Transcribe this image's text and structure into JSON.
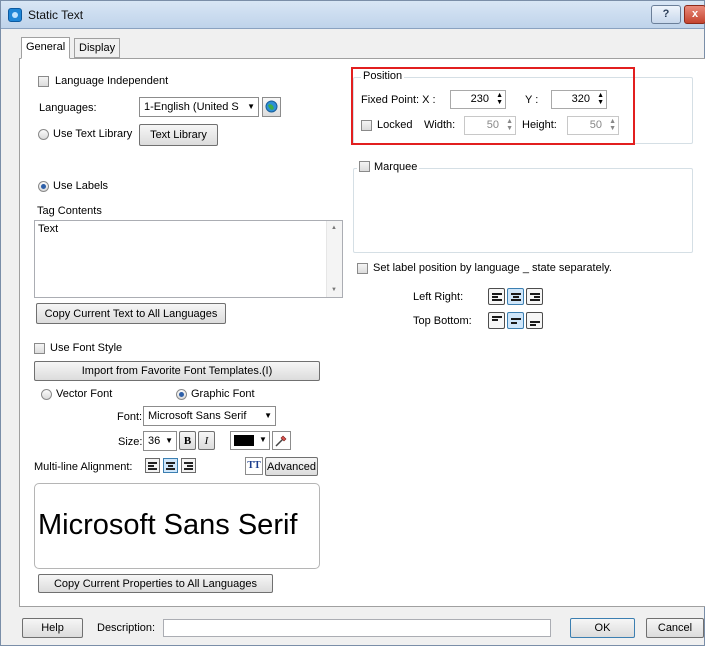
{
  "window": {
    "title": "Static Text",
    "help_glyph": "?",
    "close_glyph": "x"
  },
  "tabs": [
    {
      "label": "General"
    },
    {
      "label": "Display"
    }
  ],
  "general": {
    "language_independent_label": "Language Independent",
    "languages_label": "Languages:",
    "languages_value": "1-English (United S",
    "use_text_library_label": "Use Text Library",
    "text_library_button": "Text Library",
    "use_labels_label": "Use Labels",
    "tag_contents_label": "Tag Contents",
    "tag_contents_value": "Text",
    "copy_text_button": "Copy Current Text to All Languages",
    "use_font_style_label": "Use Font Style",
    "import_font_button": "Import from Favorite Font Templates.(I)",
    "vector_font_label": "Vector Font",
    "graphic_font_label": "Graphic Font",
    "font_label": "Font:",
    "font_value": "Microsoft Sans Serif",
    "size_label": "Size:",
    "size_value": "36",
    "bold_label": "B",
    "italic_label": "I",
    "multiline_label": "Multi-line Alignment:",
    "advanced_icon_text": "TT",
    "advanced_button": "Advanced",
    "preview_text": "Microsoft Sans Serif",
    "copy_properties_button": "Copy Current Properties to All Languages",
    "text_color": "#000000"
  },
  "position": {
    "group_label": "Position",
    "fixed_point_label": "Fixed Point:  X :",
    "x_value": "230",
    "y_label": "Y :",
    "y_value": "320",
    "locked_label": "Locked",
    "width_label": "Width:",
    "width_value": "50",
    "height_label": "Height:",
    "height_value": "50",
    "highlight_color": "#e21f1f"
  },
  "marquee": {
    "label": "Marquee"
  },
  "label_position": {
    "checkbox_label": "Set label position by language _ state separately.",
    "left_right_label": "Left Right:",
    "top_bottom_label": "Top Bottom:"
  },
  "footer": {
    "help_button": "Help",
    "description_label": "Description:",
    "ok_button": "OK",
    "cancel_button": "Cancel"
  }
}
